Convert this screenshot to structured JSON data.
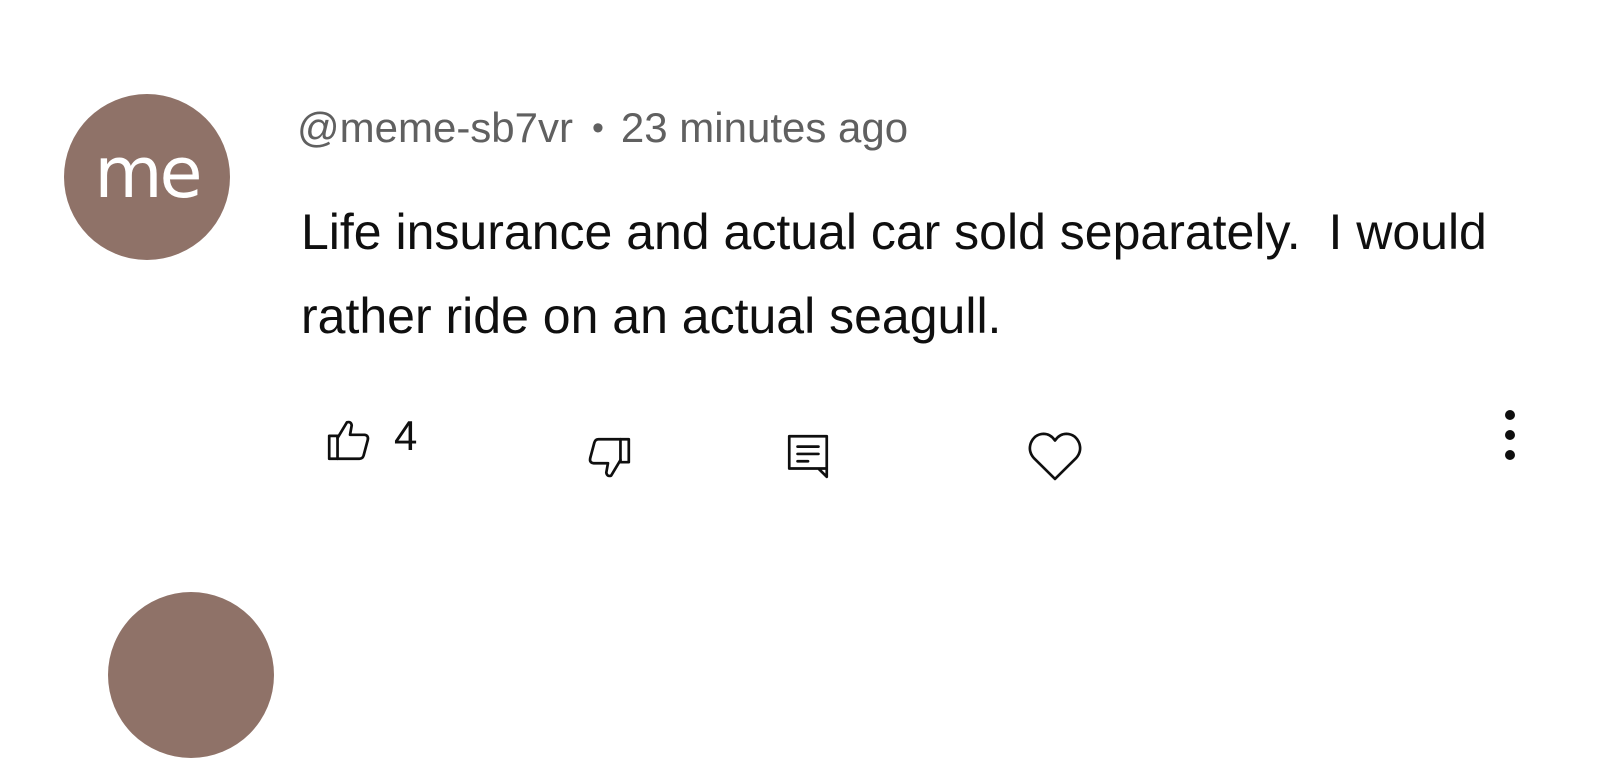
{
  "comment": {
    "avatar_initials": "me",
    "author": "@meme-sb7vr",
    "separator": "•",
    "timestamp": "23 minutes ago",
    "text": "Life insurance and actual car sold separately.  I would rather ride on an actual seagull.",
    "like_count": "4"
  },
  "icons": {
    "like": "thumbs-up-icon",
    "dislike": "thumbs-down-icon",
    "reply": "reply-comment-icon",
    "heart": "heart-icon",
    "more": "more-vertical-icon"
  },
  "colors": {
    "avatar_bg": "#8f7268",
    "meta_text": "#606060",
    "body_text": "#0f0f0f"
  }
}
